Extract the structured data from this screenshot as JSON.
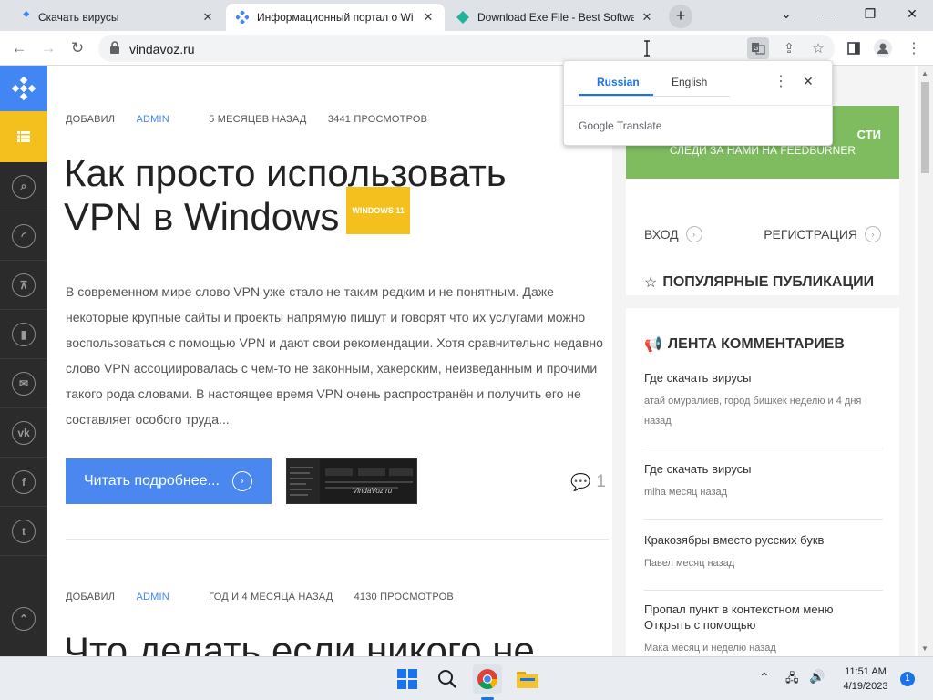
{
  "browser": {
    "tabs": [
      {
        "title": "Скачать вирусы",
        "active": false
      },
      {
        "title": "Информационный портал о Wi",
        "active": true
      },
      {
        "title": "Download Exe File - Best Softwa",
        "active": false
      }
    ],
    "new_tab": "+",
    "window_controls": {
      "minimize": "⌄",
      "restore": "—",
      "maximize": "❐",
      "close": "✕"
    },
    "url": "vindavoz.ru"
  },
  "translate_popup": {
    "languages": [
      "Russian",
      "English"
    ],
    "selected": "Russian",
    "brand_google": "Google",
    "brand_translate": " Translate"
  },
  "site": {
    "sidebar_icons": [
      "search-icon",
      "rss-icon",
      "sitemap-icon",
      "bookmark-icon",
      "mail-icon",
      "vk-icon",
      "facebook-icon",
      "twitter-icon",
      "up-icon"
    ],
    "post1": {
      "meta_prefix": "ДОБАВИЛ ",
      "author": "ADMIN",
      "time": "5 МЕСЯЦЕВ НАЗАД",
      "views": "3441 ПРОСМОТРОВ",
      "title_line1": "Как просто использовать",
      "title_line2": "VPN в Windows",
      "tag": "WINDOWS 11",
      "excerpt": "В современном мире слово VPN уже стало не таким редким и не понятным. Даже некоторые крупные сайты и проекты напрямую пишут и говорят что их услугами можно воспользоваться с помощью VPN и дают свои рекомендации. Хотя сравнительно недавно слово VPN ассоциировалась с чем-то не законным, хакерским, неизведанным и прочими такого рода словами. В настоящее время VPN очень распространён и получить его не составляет особого труда...",
      "read_more": "Читать подробнее...",
      "thumb_caption": "VindaVoz.ru",
      "comments": "1"
    },
    "post2": {
      "meta_prefix": "ДОБАВИЛ ",
      "author": "ADMIN",
      "time": "ГОД И 4 МЕСЯЦА НАЗАД",
      "views": "4130 ПРОСМОТРОВ",
      "title_line1": "Что делать если никого не"
    },
    "subscribe": {
      "line1": "СТИ",
      "line2": "СЛЕДИ ЗА НАМИ НА FEEDBURNER"
    },
    "login": "ВХОД",
    "register": "РЕГИСТРАЦИЯ",
    "popular_title": "ПОПУЛЯРНЫЕ ПУБЛИКАЦИИ",
    "comments_title": "ЛЕНТА КОММЕНТАРИЕВ",
    "comments_feed": [
      {
        "title": "Где скачать вирусы",
        "meta": "атай омуралиев, город бишкек неделю и 4 дня назад"
      },
      {
        "title": "Где скачать вирусы",
        "meta": "miha месяц назад"
      },
      {
        "title": "Кракозябры вместо русских букв",
        "meta": "Павел месяц назад"
      },
      {
        "title": "Пропал пункт в контекстном меню Открыть с помощью",
        "meta": "Мака месяц и неделю назад"
      }
    ]
  },
  "taskbar": {
    "time": "11:51 AM",
    "date": "4/19/2023",
    "notifications": "1"
  },
  "colors": {
    "accent_blue": "#4286f4",
    "accent_yellow": "#f4c01d",
    "subscribe_green": "#7ebc5f"
  }
}
